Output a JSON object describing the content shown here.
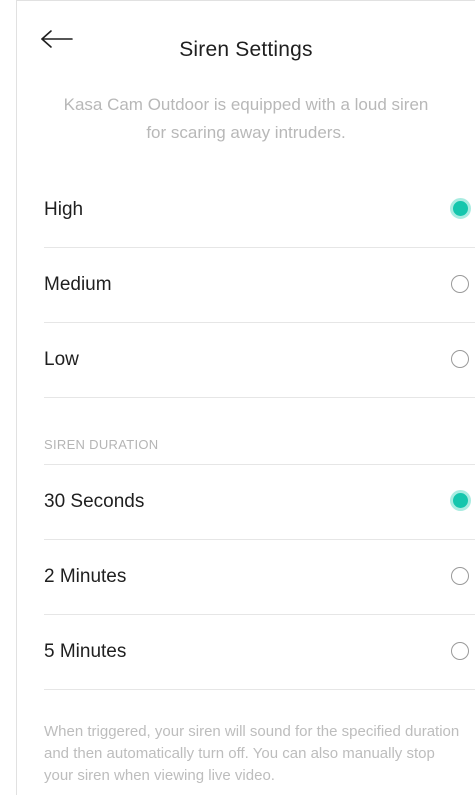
{
  "header": {
    "title": "Siren Settings",
    "back_icon": "arrow-left-icon"
  },
  "description": "Kasa Cam Outdoor is equipped with a loud siren for scaring away intruders.",
  "volume": {
    "options": [
      {
        "label": "High",
        "selected": true
      },
      {
        "label": "Medium",
        "selected": false
      },
      {
        "label": "Low",
        "selected": false
      }
    ]
  },
  "duration": {
    "section_label": "SIREN DURATION",
    "options": [
      {
        "label": "30 Seconds",
        "selected": true
      },
      {
        "label": "2 Minutes",
        "selected": false
      },
      {
        "label": "5 Minutes",
        "selected": false
      }
    ]
  },
  "footer_note": "When triggered, your siren will sound for the specified duration and then automatically turn off. You can also manually stop your siren when viewing live video.",
  "colors": {
    "accent": "#15c6ad",
    "accent_ring": "#a9ece1",
    "muted_text": "#b8b8b8",
    "divider": "#e6e6e6"
  }
}
